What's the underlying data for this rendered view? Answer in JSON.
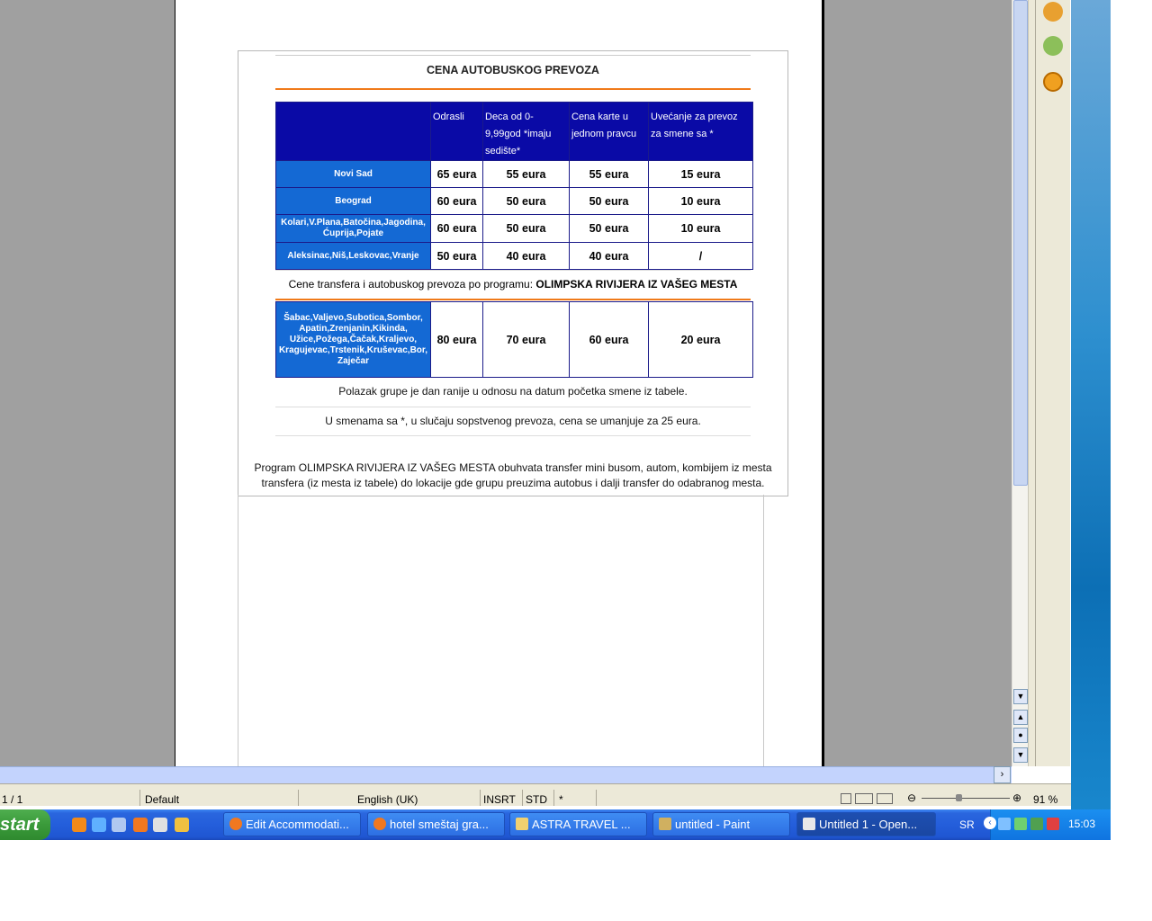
{
  "document": {
    "table_title": "CENA AUTOBUSKOG PREVOZA",
    "headers": [
      "",
      "Odrasli",
      "Deca od 0-9,99god *imaju sedište*",
      "Cena karte u jednom pravcu",
      "Uvećanje za prevoz za smene sa *"
    ],
    "rows": [
      {
        "city": "Novi Sad",
        "values": [
          "65 eura",
          "55 eura",
          "55 eura",
          "15 eura"
        ]
      },
      {
        "city": "Beograd",
        "values": [
          "60 eura",
          "50 eura",
          "50 eura",
          "10 eura"
        ]
      },
      {
        "city": "Kolari,V.Plana,Batočina,Jagodina, Ćuprija,Pojate",
        "values": [
          "60 eura",
          "50 eura",
          "50 eura",
          "10 eura"
        ]
      },
      {
        "city": "Aleksinac,Niš,Leskovac,Vranje",
        "values": [
          "50 eura",
          "40 eura",
          "40 eura",
          "/"
        ]
      }
    ],
    "program_prefix": "Cene transfera i autobuskog prevoza po programu: ",
    "program_name": "OLIMPSKA RIVIJERA IZ VAŠEG MESTA",
    "program_row": {
      "city": "Šabac,Valjevo,Subotica,Sombor, Apatin,Zrenjanin,Kikinda, Užice,Požega,Čačak,Kraljevo, Kragujevac,Trstenik,Kruševac,Bor, Zaječar",
      "values": [
        "80 eura",
        "70 eura",
        "60 eura",
        "20 eura"
      ]
    },
    "note_1": "Polazak grupe je dan ranije u odnosu na datum početka smene iz tabele.",
    "note_2": "U smenama sa *, u slučaju sopstvenog prevoza, cena se umanjuje za 25 eura.",
    "program_description": "Program OLIMPSKA RIVIJERA IZ VAŠEG MESTA obuhvata transfer mini busom, autom, kombijem iz mesta transfera (iz mesta iz tabele) do lokacije gde grupu preuzima autobus i dalji transfer do odabranog mesta."
  },
  "statusbar": {
    "page": "1 / 1",
    "style": "Default",
    "language": "English (UK)",
    "insert_mode": "INSRT",
    "selection_mode": "STD",
    "modified": "*",
    "zoom": "91 %"
  },
  "taskbar": {
    "start_label": "start",
    "buttons": [
      {
        "label": "Edit Accommodati...",
        "icon": "firefox-icon"
      },
      {
        "label": "hotel smeštaj gra...",
        "icon": "firefox-icon"
      },
      {
        "label": "ASTRA TRAVEL ...",
        "icon": "folder-icon"
      },
      {
        "label": "untitled - Paint",
        "icon": "paint-icon"
      },
      {
        "label": "Untitled 1 - Open...",
        "icon": "openoffice-icon"
      }
    ],
    "language": "SR",
    "clock": "15:03"
  },
  "colors": {
    "header_blue": "#0a0aa6",
    "row_blue": "#1469d4",
    "accent_orange": "#f07a1a",
    "taskbar_blue": "#245edb"
  }
}
